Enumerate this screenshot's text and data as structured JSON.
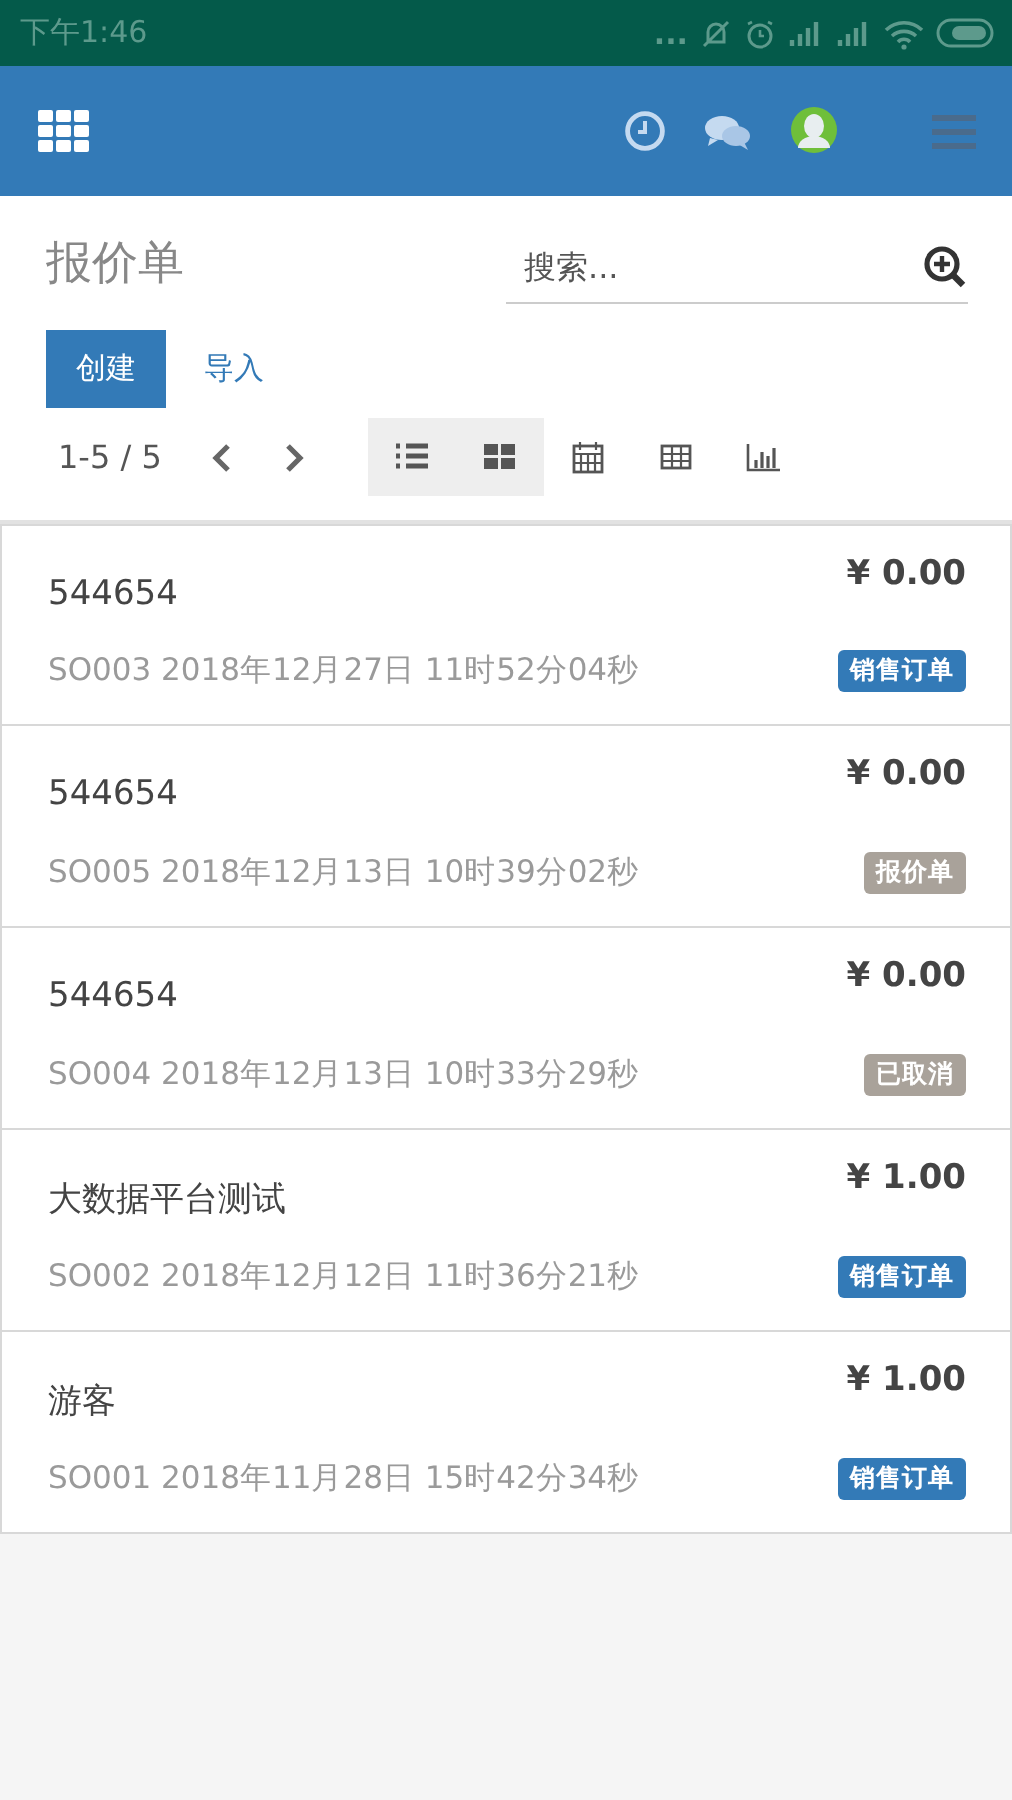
{
  "status_bar": {
    "time": "下午1:46",
    "dots": "..."
  },
  "nav": {
    "title": "报价单"
  },
  "search": {
    "placeholder": "搜索..."
  },
  "buttons": [
    {
      "label": "创建",
      "kind": "primary"
    },
    {
      "label": "导入",
      "kind": "link"
    }
  ],
  "pager": {
    "range": "1-5 / 5"
  },
  "views": [
    {
      "kind": "list",
      "selected": true
    },
    {
      "kind": "kanban",
      "selected": true
    },
    {
      "kind": "calendar",
      "selected": false
    },
    {
      "kind": "pivot",
      "selected": false
    },
    {
      "kind": "graph",
      "selected": false
    }
  ],
  "records": [
    {
      "name": "544654",
      "amount": "¥ 0.00",
      "reference": "SO003 2018年12月27日 11时52分04秒",
      "status": "销售订单",
      "color": "#337ab7"
    },
    {
      "name": "544654",
      "amount": "¥ 0.00",
      "reference": "SO005 2018年12月13日 10时39分02秒",
      "status": "报价单",
      "color": "#a9a29a"
    },
    {
      "name": "544654",
      "amount": "¥ 0.00",
      "reference": "SO004 2018年12月13日 10时33分29秒",
      "status": "已取消",
      "color": "#a9a29a"
    },
    {
      "name": "大数据平台测试",
      "amount": "¥ 1.00",
      "reference": "SO002 2018年12月12日 11时36分21秒",
      "status": "销售订单",
      "color": "#337ab7"
    },
    {
      "name": "游客",
      "amount": "¥ 1.00",
      "reference": "SO001 2018年11月28日 15时42分34秒",
      "status": "销售订单",
      "color": "#337ab7"
    }
  ]
}
